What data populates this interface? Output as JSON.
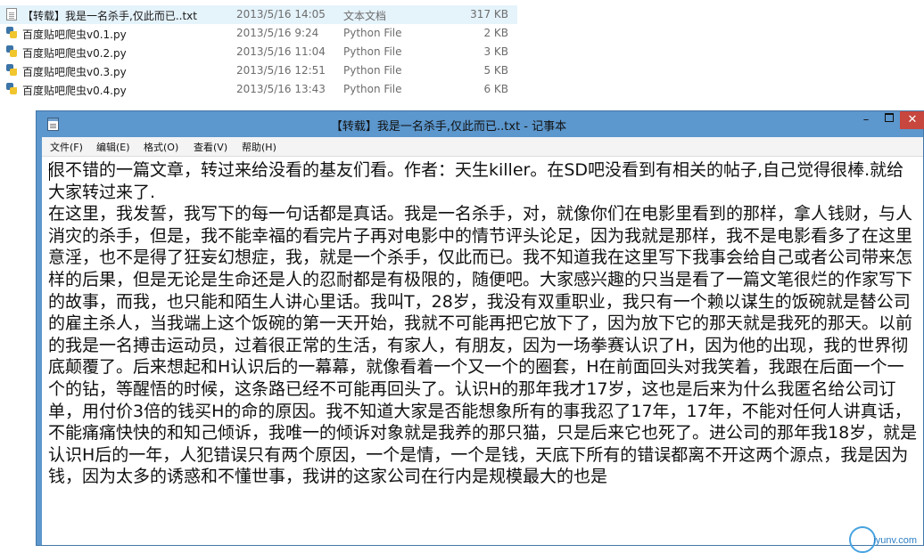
{
  "files": [
    {
      "name": "【转载】我是一名杀手,仅此而已..txt",
      "date": "2013/5/16 14:05",
      "type": "文本文档",
      "size": "317 KB",
      "icon": "text-file-icon",
      "selected": true
    },
    {
      "name": "百度贴吧爬虫v0.1.py",
      "date": "2013/5/16 9:24",
      "type": "Python File",
      "size": "2 KB",
      "icon": "python-file-icon",
      "selected": false
    },
    {
      "name": "百度贴吧爬虫v0.2.py",
      "date": "2013/5/16 11:04",
      "type": "Python File",
      "size": "3 KB",
      "icon": "python-file-icon",
      "selected": false
    },
    {
      "name": "百度贴吧爬虫v0.3.py",
      "date": "2013/5/16 12:51",
      "type": "Python File",
      "size": "5 KB",
      "icon": "python-file-icon",
      "selected": false
    },
    {
      "name": "百度贴吧爬虫v0.4.py",
      "date": "2013/5/16 13:43",
      "type": "Python File",
      "size": "6 KB",
      "icon": "python-file-icon",
      "selected": false
    }
  ],
  "notepad": {
    "title": "【转载】我是一名杀手,仅此而已..txt - 记事本",
    "controls": {
      "minimize": "–",
      "close": "✕"
    },
    "menu": [
      "文件(F)",
      "编辑(E)",
      "格式(O)",
      "查看(V)",
      "帮助(H)"
    ],
    "text": "很不错的一篇文章，转过来给没看的基友们看。作者：天生killer。在SD吧没看到有相关的帖子,自己觉得很棒.就给大家转过来了.\n在这里，我发誓，我写下的每一句话都是真话。我是一名杀手，对，就像你们在电影里看到的那样，拿人钱财，与人消灾的杀手，但是，我不能幸福的看完片子再对电影中的情节评头论足，因为我就是那样，我不是电影看多了在这里意淫，也不是得了狂妄幻想症，我，就是一个杀手，仅此而已。我不知道我在这里写下我事会给自己或者公司带来怎样的后果，但是无论是生命还是人的忍耐都是有极限的，随便吧。大家感兴趣的只当是看了一篇文笔很烂的作家写下的故事，而我，也只能和陌生人讲心里话。我叫T，28岁，我没有双重职业，我只有一个赖以谋生的饭碗就是替公司的雇主杀人，当我端上这个饭碗的第一天开始，我就不可能再把它放下了，因为放下它的那天就是我死的那天。以前的我是一名搏击运动员，过着很正常的生活，有家人，有朋友，因为一场拳赛认识了H，因为他的出现，我的世界彻底颠覆了。后来想起和H认识后的一幕幕，就像看着一个又一个的圈套，H在前面回头对我笑着，我跟在后面一个一个的钻，等醒悟的时候，这条路已经不可能再回头了。认识H的那年我才17岁，这也是后来为什么我匿名给公司订单，用付价3倍的钱买H的命的原因。我不知道大家是否能想象所有的事我忍了17年，17年，不能对任何人讲真话，不能痛痛快快的和知己倾诉，我唯一的倾诉对象就是我养的那只猫，只是后来它也死了。进公司的那年我18岁，就是认识H后的一年，人犯错误只有两个原因，一个是情，一个是钱，天底下所有的错误都离不开这两个源点，我是因为钱，因为太多的诱惑和不懂世事，我讲的这家公司在行内是规模最大的也是"
  },
  "watermark": {
    "text": "iyunv.com"
  }
}
